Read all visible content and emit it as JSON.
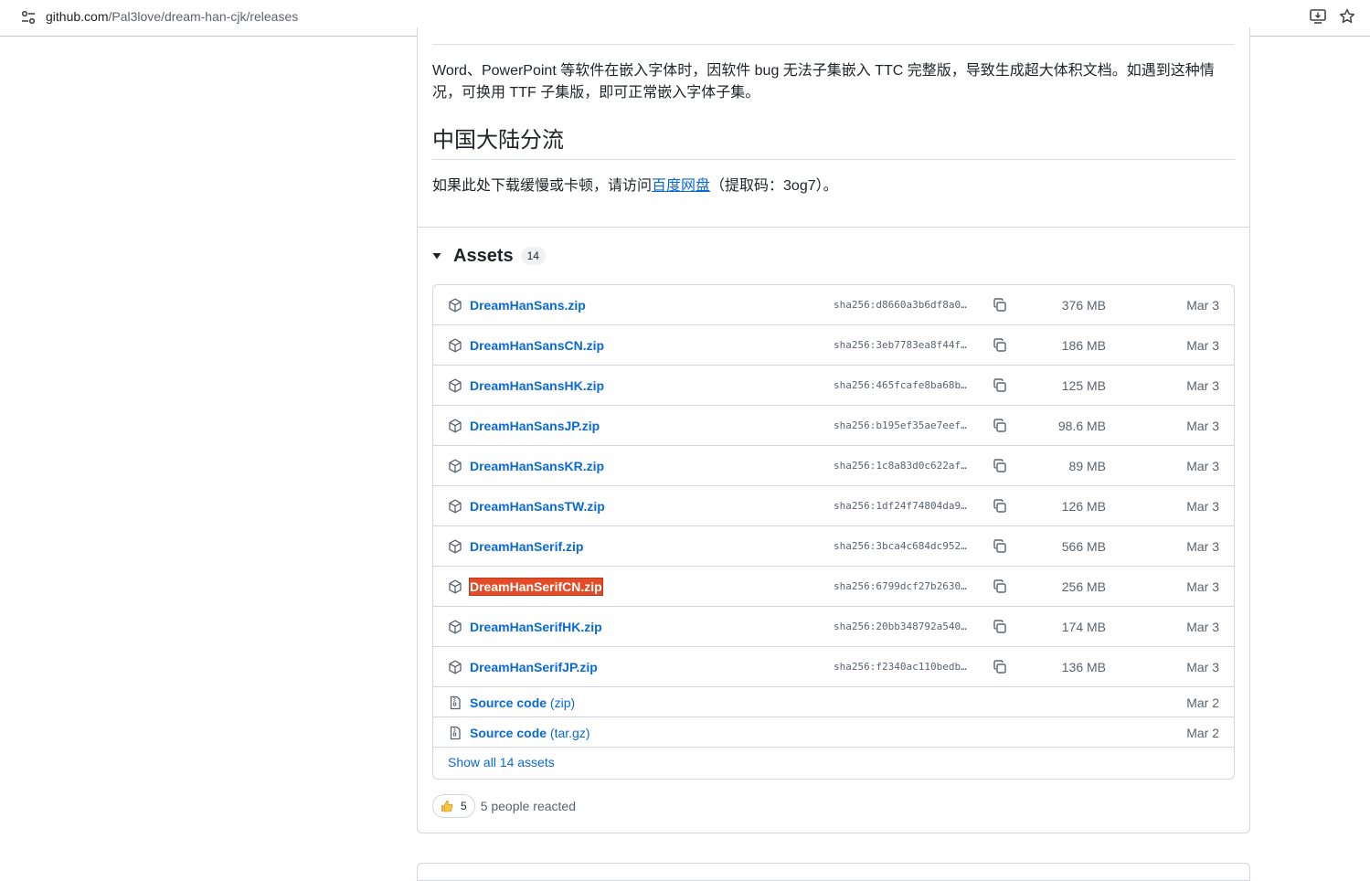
{
  "browser": {
    "url_host": "github.com",
    "url_path": "/Pal3love/dream-han-cjk/releases",
    "site_info_icon": "tune-icon",
    "install_icon": "install-app-icon",
    "bookmark_icon": "star-icon"
  },
  "release": {
    "paragraph_embed": "Word、PowerPoint 等软件在嵌入字体时，因软件 bug 无法子集嵌入 TTC 完整版，导致生成超大体积文档。如遇到这种情况，可换用 TTF 子集版，即可正常嵌入字体子集。",
    "mirror_heading": "中国大陆分流",
    "mirror_text_before": "如果此处下载缓慢或卡顿，请访问",
    "mirror_link": "百度网盘",
    "mirror_text_after": "（提取码：3og7）。"
  },
  "assets": {
    "title": "Assets",
    "count": "14",
    "items": [
      {
        "name": "DreamHanSans.zip",
        "sha": "sha256:d8660a3b6df8a0…",
        "size": "376 MB",
        "date": "Mar 3"
      },
      {
        "name": "DreamHanSansCN.zip",
        "sha": "sha256:3eb7783ea8f44f…",
        "size": "186 MB",
        "date": "Mar 3"
      },
      {
        "name": "DreamHanSansHK.zip",
        "sha": "sha256:465fcafe8ba68b…",
        "size": "125 MB",
        "date": "Mar 3"
      },
      {
        "name": "DreamHanSansJP.zip",
        "sha": "sha256:b195ef35ae7eef…",
        "size": "98.6 MB",
        "date": "Mar 3"
      },
      {
        "name": "DreamHanSansKR.zip",
        "sha": "sha256:1c8a83d0c622af…",
        "size": "89 MB",
        "date": "Mar 3"
      },
      {
        "name": "DreamHanSansTW.zip",
        "sha": "sha256:1df24f74804da9…",
        "size": "126 MB",
        "date": "Mar 3"
      },
      {
        "name": "DreamHanSerif.zip",
        "sha": "sha256:3bca4c684dc952…",
        "size": "566 MB",
        "date": "Mar 3"
      },
      {
        "name": "DreamHanSerifCN.zip",
        "sha": "sha256:6799dcf27b2630…",
        "size": "256 MB",
        "date": "Mar 3",
        "selected": true
      },
      {
        "name": "DreamHanSerifHK.zip",
        "sha": "sha256:20bb348792a540…",
        "size": "174 MB",
        "date": "Mar 3"
      },
      {
        "name": "DreamHanSerifJP.zip",
        "sha": "sha256:f2340ac110bedb…",
        "size": "136 MB",
        "date": "Mar 3"
      }
    ],
    "source": [
      {
        "label": "Source code",
        "suffix": "(zip)",
        "date": "Mar 2"
      },
      {
        "label": "Source code",
        "suffix": "(tar.gz)",
        "date": "Mar 2"
      }
    ],
    "show_all": "Show all 14 assets",
    "package_icon": "package-icon",
    "source_icon": "file-zip-icon",
    "copy_icon": "copy-icon"
  },
  "reactions": {
    "emoji": "👍",
    "count": "5",
    "text": "5 people reacted"
  },
  "colors": {
    "link": "#0969da",
    "selected_highlight": "#e34c26",
    "border": "#d0d7de"
  }
}
